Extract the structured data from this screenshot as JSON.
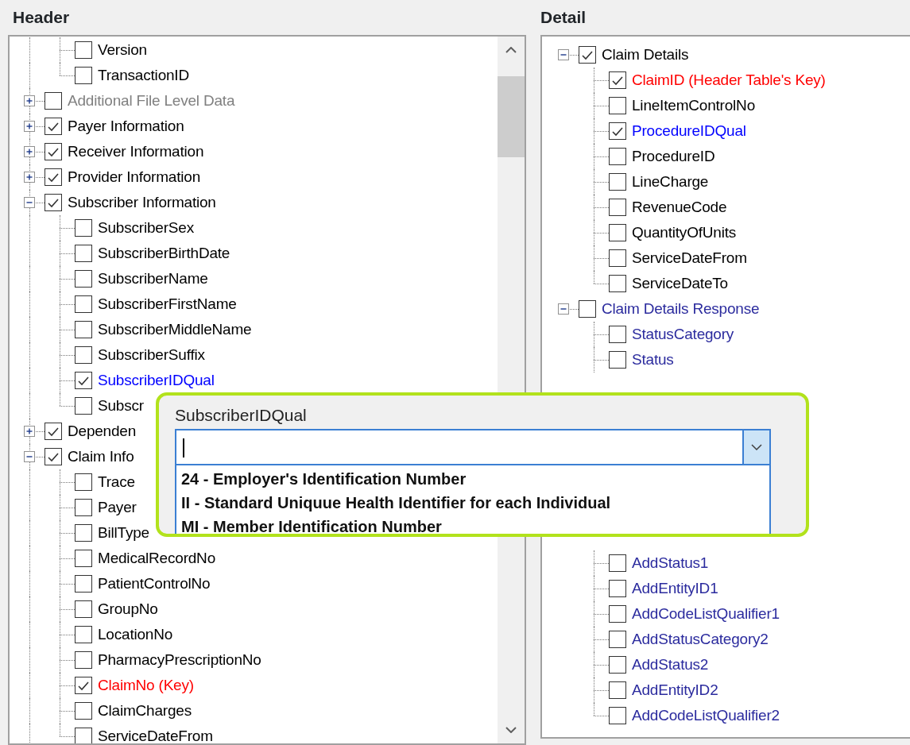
{
  "panels": [
    {
      "title": "Header",
      "has_scrollbar": true,
      "scrolled_children": [
        {
          "label": "Version",
          "checked": false,
          "color": "#000000"
        },
        {
          "label": "TransactionID",
          "checked": false,
          "color": "#000000"
        }
      ],
      "tree": [
        {
          "label": "Additional File Level Data",
          "checked": false,
          "expanded": false,
          "color": "#808080"
        },
        {
          "label": "Payer Information",
          "checked": true,
          "expanded": false,
          "color": "#000000"
        },
        {
          "label": "Receiver Information",
          "checked": true,
          "expanded": false,
          "color": "#000000"
        },
        {
          "label": "Provider Information",
          "checked": true,
          "expanded": false,
          "color": "#000000"
        },
        {
          "label": "Subscriber Information",
          "checked": true,
          "expanded": true,
          "color": "#000000",
          "children": [
            {
              "label": "SubscriberSex",
              "checked": false,
              "color": "#000000"
            },
            {
              "label": "SubscriberBirthDate",
              "checked": false,
              "color": "#000000"
            },
            {
              "label": "SubscriberName",
              "checked": false,
              "color": "#000000"
            },
            {
              "label": "SubscriberFirstName",
              "checked": false,
              "color": "#000000"
            },
            {
              "label": "SubscriberMiddleName",
              "checked": false,
              "color": "#000000"
            },
            {
              "label": "SubscriberSuffix",
              "checked": false,
              "color": "#000000"
            },
            {
              "label": "SubscriberIDQual",
              "checked": true,
              "color": "#0000ff"
            },
            {
              "label": "Subscr",
              "checked": false,
              "color": "#000000"
            }
          ]
        },
        {
          "label": "Dependen",
          "checked": true,
          "expanded": false,
          "color": "#000000"
        },
        {
          "label": "Claim Info",
          "checked": true,
          "expanded": true,
          "color": "#000000",
          "children": [
            {
              "label": "Trace",
              "checked": false,
              "color": "#000000"
            },
            {
              "label": "Payer",
              "checked": false,
              "color": "#000000"
            },
            {
              "label": "BillType",
              "checked": false,
              "color": "#000000"
            },
            {
              "label": "MedicalRecordNo",
              "checked": false,
              "color": "#000000"
            },
            {
              "label": "PatientControlNo",
              "checked": false,
              "color": "#000000"
            },
            {
              "label": "GroupNo",
              "checked": false,
              "color": "#000000"
            },
            {
              "label": "LocationNo",
              "checked": false,
              "color": "#000000"
            },
            {
              "label": "PharmacyPrescriptionNo",
              "checked": false,
              "color": "#000000"
            },
            {
              "label": "ClaimNo (Key)",
              "checked": true,
              "color": "#ff0000"
            },
            {
              "label": "ClaimCharges",
              "checked": false,
              "color": "#000000"
            },
            {
              "label": "ServiceDateFrom",
              "checked": false,
              "color": "#000000"
            }
          ]
        }
      ]
    },
    {
      "title": "Detail",
      "has_scrollbar": false,
      "tree": [
        {
          "label": "Claim Details",
          "checked": true,
          "expanded": true,
          "color": "#000000",
          "children": [
            {
              "label": "ClaimID (Header Table's Key)",
              "checked": true,
              "color": "#ff0000"
            },
            {
              "label": "LineItemControlNo",
              "checked": false,
              "color": "#000000"
            },
            {
              "label": "ProcedureIDQual",
              "checked": true,
              "color": "#0000ff"
            },
            {
              "label": "ProcedureID",
              "checked": false,
              "color": "#000000"
            },
            {
              "label": "LineCharge",
              "checked": false,
              "color": "#000000"
            },
            {
              "label": "RevenueCode",
              "checked": false,
              "color": "#000000"
            },
            {
              "label": "QuantityOfUnits",
              "checked": false,
              "color": "#000000"
            },
            {
              "label": "ServiceDateFrom",
              "checked": false,
              "color": "#000000"
            },
            {
              "label": "ServiceDateTo",
              "checked": false,
              "color": "#000000"
            }
          ]
        },
        {
          "label": "Claim Details Response",
          "checked": false,
          "expanded": true,
          "color": "#2b2b9e",
          "children": [
            {
              "label": "StatusCategory",
              "checked": false,
              "color": "#2b2b9e"
            },
            {
              "label": "Status",
              "checked": false,
              "color": "#2b2b9e"
            },
            {
              "label": "AddStatus1",
              "checked": false,
              "color": "#2b2b9e",
              "gap_before": true
            },
            {
              "label": "AddEntityID1",
              "checked": false,
              "color": "#2b2b9e"
            },
            {
              "label": "AddCodeListQualifier1",
              "checked": false,
              "color": "#2b2b9e"
            },
            {
              "label": "AddStatusCategory2",
              "checked": false,
              "color": "#2b2b9e"
            },
            {
              "label": "AddStatus2",
              "checked": false,
              "color": "#2b2b9e"
            },
            {
              "label": "AddEntityID2",
              "checked": false,
              "color": "#2b2b9e"
            },
            {
              "label": "AddCodeListQualifier2",
              "checked": false,
              "color": "#2b2b9e"
            }
          ]
        }
      ]
    }
  ],
  "popup": {
    "label": "SubscriberIDQual",
    "options": [
      {
        "label": "24 - Employer's Identification Number",
        "selected": false
      },
      {
        "label": "II - Standard Uniquue Health Identifier for each Individual",
        "selected": false
      },
      {
        "label": "MI - Member Identification Number",
        "selected": false
      }
    ]
  }
}
